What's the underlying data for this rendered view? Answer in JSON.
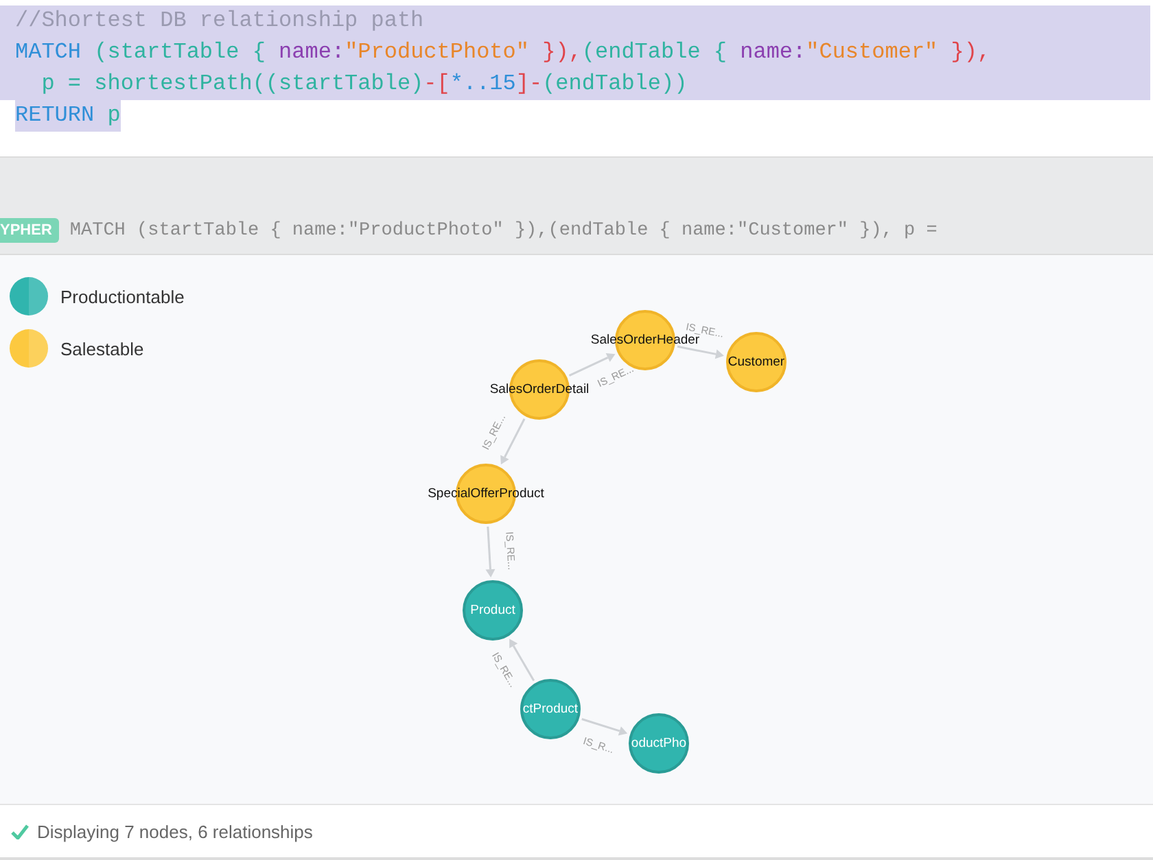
{
  "editor": {
    "lines": [
      {
        "selected": true,
        "tokens": [
          {
            "kind": "comment",
            "text": "//Shortest DB relationship path"
          }
        ]
      },
      {
        "selected": true,
        "tokens": [
          {
            "kind": "keyword",
            "text": "MATCH"
          },
          {
            "kind": "ident",
            "text": " (startTable { "
          },
          {
            "kind": "prop",
            "text": "name:"
          },
          {
            "kind": "string",
            "text": "\"ProductPhoto\""
          },
          {
            "kind": "punct",
            "text": " }),"
          },
          {
            "kind": "ident",
            "text": "(endTable { "
          },
          {
            "kind": "prop",
            "text": "name:"
          },
          {
            "kind": "string",
            "text": "\"Customer\""
          },
          {
            "kind": "punct",
            "text": " }),"
          }
        ]
      },
      {
        "selected": true,
        "tokens": [
          {
            "kind": "ident",
            "text": "  p = shortestPath((startTable)"
          },
          {
            "kind": "punct",
            "text": "-["
          },
          {
            "kind": "number",
            "text": "*..15"
          },
          {
            "kind": "punct",
            "text": "]-"
          },
          {
            "kind": "ident",
            "text": "(endTable))"
          }
        ]
      },
      {
        "selected": true,
        "tokens": [
          {
            "kind": "keyword",
            "text": "RETURN"
          },
          {
            "kind": "ident",
            "text": " p"
          }
        ]
      }
    ]
  },
  "result_bar": {
    "badge": "YPHER",
    "query": "MATCH (startTable { name:\"ProductPhoto\" }),(endTable { name:\"Customer\" }), p ="
  },
  "legend": [
    {
      "kind": "production",
      "label": "Productiontable",
      "color": "#30b5ae"
    },
    {
      "kind": "sales",
      "label": "Salestable",
      "color": "#fcc940"
    }
  ],
  "graph": {
    "nodes": [
      {
        "kind": "sales",
        "label": "SalesOrderHeader"
      },
      {
        "kind": "sales",
        "label": "Customer"
      },
      {
        "kind": "sales",
        "label": "SalesOrderDetail"
      },
      {
        "kind": "sales",
        "label": "SpecialOfferProduct"
      },
      {
        "kind": "production",
        "label": "Product"
      },
      {
        "kind": "production",
        "label": "ctProduct"
      },
      {
        "kind": "production",
        "label": "oductPho"
      }
    ],
    "relationships": [
      {
        "label": "IS_RE..."
      },
      {
        "label": "IS_RE..."
      },
      {
        "label": "IS_RE..."
      },
      {
        "label": "IS_RE..."
      },
      {
        "label": "IS_RE..."
      },
      {
        "label": "IS_R..."
      }
    ]
  },
  "status": {
    "text": "Displaying 7 nodes, 6 relationships"
  }
}
